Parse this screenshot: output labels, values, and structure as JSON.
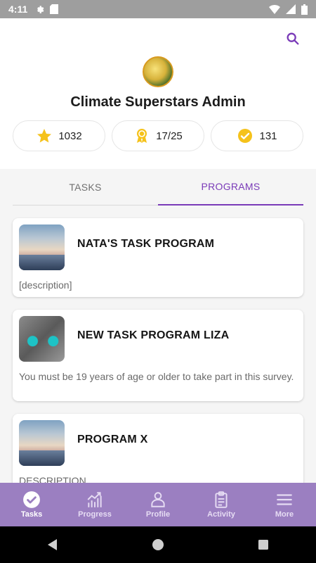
{
  "status_bar": {
    "time": "4:11"
  },
  "header": {
    "title": "Climate Superstars Admin"
  },
  "stats": {
    "stars": "1032",
    "badges": "17/25",
    "completed": "131"
  },
  "tabs": [
    {
      "label": "TASKS",
      "active": false
    },
    {
      "label": "PROGRAMS",
      "active": true
    }
  ],
  "programs": [
    {
      "title": "NATA'S TASK PROGRAM",
      "description": "[description]",
      "image": "sky-clouds"
    },
    {
      "title": "NEW TASK PROGRAM LIZA",
      "description": "You must be 19 years of age or older to take part in this survey.",
      "image": "cat-face"
    },
    {
      "title": "PROGRAM X",
      "description": "DESCRIPTION",
      "image": "sky-clouds"
    }
  ],
  "bottom_nav": [
    {
      "label": "Tasks",
      "icon": "check-circle-icon",
      "active": true
    },
    {
      "label": "Progress",
      "icon": "chart-icon",
      "active": false
    },
    {
      "label": "Profile",
      "icon": "person-icon",
      "active": false
    },
    {
      "label": "Activity",
      "icon": "clipboard-icon",
      "active": false
    },
    {
      "label": "More",
      "icon": "menu-icon",
      "active": false
    }
  ],
  "colors": {
    "accent": "#7a3bb8",
    "nav_bg": "#9b7fc1",
    "star": "#f5c21b"
  }
}
